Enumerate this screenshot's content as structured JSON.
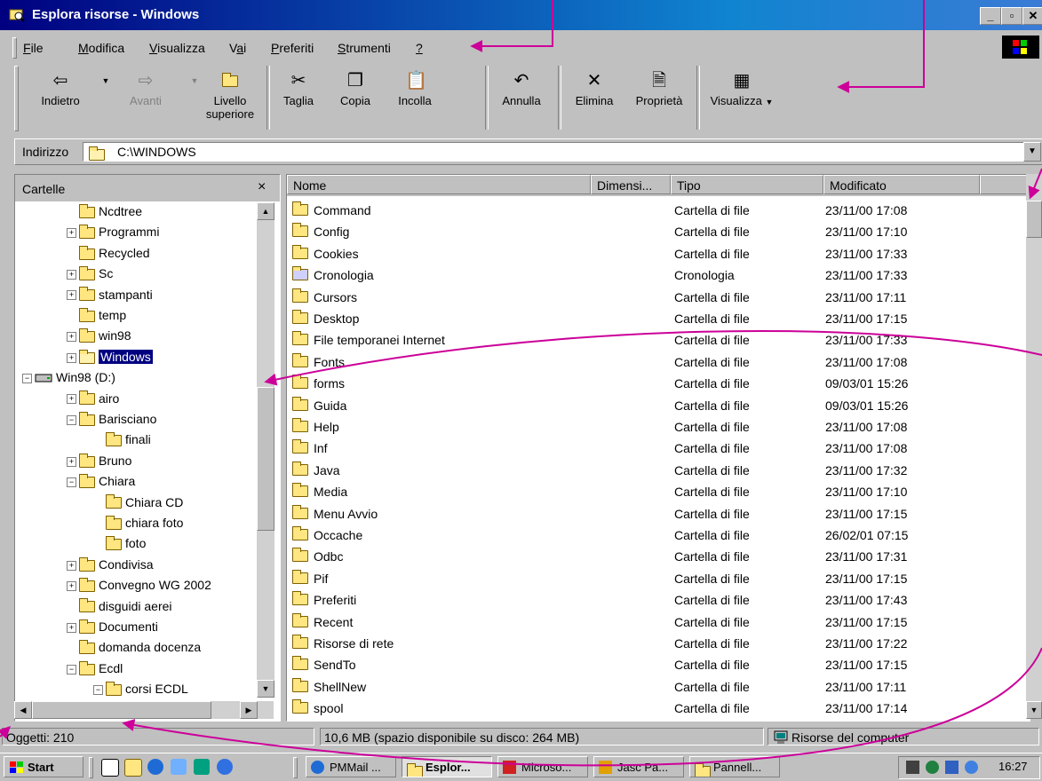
{
  "window": {
    "title": "Esplora risorse - Windows"
  },
  "menu": [
    {
      "pre": "",
      "u": "F",
      "post": "ile"
    },
    {
      "pre": "",
      "u": "M",
      "post": "odifica"
    },
    {
      "pre": "",
      "u": "V",
      "post": "isualizza"
    },
    {
      "pre": "V",
      "u": "a",
      "post": "i"
    },
    {
      "pre": "",
      "u": "P",
      "post": "referiti"
    },
    {
      "pre": "",
      "u": "S",
      "post": "trumenti"
    },
    {
      "pre": "",
      "u": "?",
      "post": ""
    }
  ],
  "toolbar": {
    "back": "Indietro",
    "forward": "Avanti",
    "up_line1": "Livello",
    "up_line2": "superiore",
    "cut": "Taglia",
    "copy": "Copia",
    "paste": "Incolla",
    "undo": "Annulla",
    "delete": "Elimina",
    "properties": "Proprietà",
    "views": "Visualizza"
  },
  "address": {
    "label": "Indirizzo",
    "value": "C:\\WINDOWS"
  },
  "tree": {
    "title": "Cartelle",
    "close": "×",
    "items": [
      {
        "label": "Ncdtree",
        "indent": 1,
        "box": ""
      },
      {
        "label": "Programmi",
        "indent": 1,
        "box": "+"
      },
      {
        "label": "Recycled",
        "indent": 1,
        "box": ""
      },
      {
        "label": "Sc",
        "indent": 1,
        "box": "+"
      },
      {
        "label": "stampanti",
        "indent": 1,
        "box": "+"
      },
      {
        "label": "temp",
        "indent": 1,
        "box": ""
      },
      {
        "label": "win98",
        "indent": 1,
        "box": "+"
      },
      {
        "label": "Windows",
        "indent": 1,
        "box": "+",
        "selected": true
      },
      {
        "label": "Win98 (D:)",
        "indent": 0,
        "box": "-",
        "drive": true
      },
      {
        "label": "airo",
        "indent": 1,
        "box": "+"
      },
      {
        "label": "Barisciano",
        "indent": 1,
        "box": "-"
      },
      {
        "label": "finali",
        "indent": 2,
        "box": ""
      },
      {
        "label": "Bruno",
        "indent": 1,
        "box": "+"
      },
      {
        "label": "Chiara",
        "indent": 1,
        "box": "-"
      },
      {
        "label": "Chiara CD",
        "indent": 2,
        "box": ""
      },
      {
        "label": "chiara foto",
        "indent": 2,
        "box": ""
      },
      {
        "label": "foto",
        "indent": 2,
        "box": ""
      },
      {
        "label": "Condivisa",
        "indent": 1,
        "box": "+"
      },
      {
        "label": "Convegno WG 2002",
        "indent": 1,
        "box": "+"
      },
      {
        "label": "disguidi aerei",
        "indent": 1,
        "box": ""
      },
      {
        "label": "Documenti",
        "indent": 1,
        "box": "+"
      },
      {
        "label": "domanda docenza",
        "indent": 1,
        "box": ""
      },
      {
        "label": "Ecdl",
        "indent": 1,
        "box": "-"
      },
      {
        "label": "corsi ECDL",
        "indent": 2,
        "box": "-"
      }
    ]
  },
  "list": {
    "columns": [
      "Nome",
      "Dimensi...",
      "Tipo",
      "Modificato"
    ],
    "rows": [
      {
        "name": "Command",
        "type": "Cartella di file",
        "modified": "23/11/00 17:08"
      },
      {
        "name": "Config",
        "type": "Cartella di file",
        "modified": "23/11/00 17:10"
      },
      {
        "name": "Cookies",
        "type": "Cartella di file",
        "modified": "23/11/00 17:33"
      },
      {
        "name": "Cronologia",
        "type": "Cronologia",
        "modified": "23/11/00 17:33"
      },
      {
        "name": "Cursors",
        "type": "Cartella di file",
        "modified": "23/11/00 17:11"
      },
      {
        "name": "Desktop",
        "type": "Cartella di file",
        "modified": "23/11/00 17:15"
      },
      {
        "name": "File temporanei Internet",
        "type": "Cartella di file",
        "modified": "23/11/00 17:33"
      },
      {
        "name": "Fonts",
        "type": "Cartella di file",
        "modified": "23/11/00 17:08"
      },
      {
        "name": "forms",
        "type": "Cartella di file",
        "modified": "09/03/01 15:26"
      },
      {
        "name": "Guida",
        "type": "Cartella di file",
        "modified": "09/03/01 15:26"
      },
      {
        "name": "Help",
        "type": "Cartella di file",
        "modified": "23/11/00 17:08"
      },
      {
        "name": "Inf",
        "type": "Cartella di file",
        "modified": "23/11/00 17:08"
      },
      {
        "name": "Java",
        "type": "Cartella di file",
        "modified": "23/11/00 17:32"
      },
      {
        "name": "Media",
        "type": "Cartella di file",
        "modified": "23/11/00 17:10"
      },
      {
        "name": "Menu Avvio",
        "type": "Cartella di file",
        "modified": "23/11/00 17:15"
      },
      {
        "name": "Occache",
        "type": "Cartella di file",
        "modified": "26/02/01 07:15"
      },
      {
        "name": "Odbc",
        "type": "Cartella di file",
        "modified": "23/11/00 17:31"
      },
      {
        "name": "Pif",
        "type": "Cartella di file",
        "modified": "23/11/00 17:15"
      },
      {
        "name": "Preferiti",
        "type": "Cartella di file",
        "modified": "23/11/00 17:43"
      },
      {
        "name": "Recent",
        "type": "Cartella di file",
        "modified": "23/11/00 17:15"
      },
      {
        "name": "Risorse di rete",
        "type": "Cartella di file",
        "modified": "23/11/00 17:22"
      },
      {
        "name": "SendTo",
        "type": "Cartella di file",
        "modified": "23/11/00 17:15"
      },
      {
        "name": "ShellNew",
        "type": "Cartella di file",
        "modified": "23/11/00 17:11"
      },
      {
        "name": "spool",
        "type": "Cartella di file",
        "modified": "23/11/00 17:14"
      }
    ]
  },
  "status": {
    "objects": "Oggetti: 210",
    "size": "10,6 MB (spazio disponibile su disco: 264 MB)",
    "location": "Risorse del computer"
  },
  "taskbar": {
    "start": "Start",
    "tasks": [
      "PMMail ...",
      "Esplor...",
      "Microso...",
      "Jasc Pa...",
      "Pannell..."
    ],
    "clock": "16:27"
  },
  "colors": {
    "annotation_arrow": "#cc0099",
    "titlebar": "#000080",
    "selection": "#000080",
    "background": "#ffffcc"
  }
}
